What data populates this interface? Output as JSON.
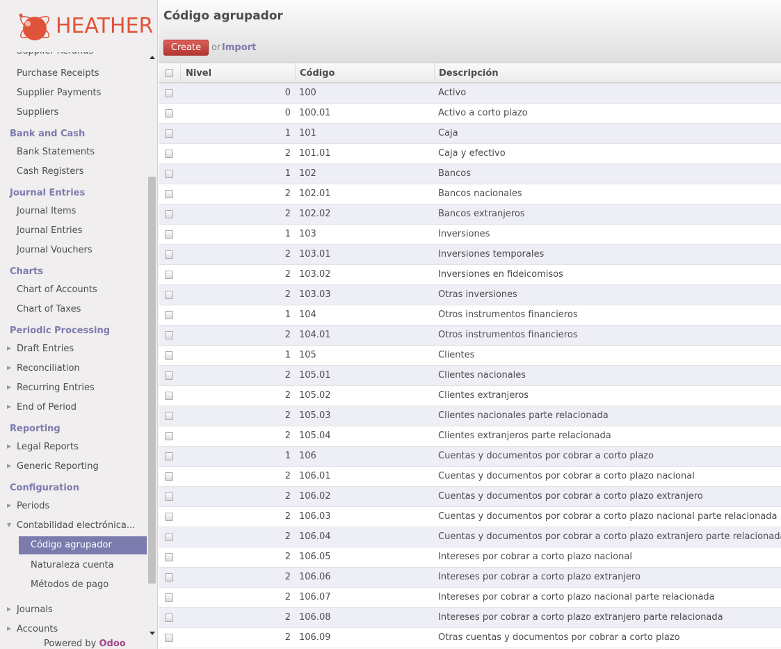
{
  "brand": {
    "name": "HEATHER",
    "powered_prefix": "Powered by ",
    "powered_brand": "Odoo",
    "accent": "#7c7bad",
    "logo_color": "#e0533b"
  },
  "sidebar": {
    "cut_item": "Supplier Refunds",
    "purchase_items": [
      "Purchase Receipts",
      "Supplier Payments",
      "Suppliers"
    ],
    "bank_cash": {
      "title": "Bank and Cash",
      "items": [
        "Bank Statements",
        "Cash Registers"
      ]
    },
    "journal_entries": {
      "title": "Journal Entries",
      "items": [
        "Journal Items",
        "Journal Entries",
        "Journal Vouchers"
      ]
    },
    "charts": {
      "title": "Charts",
      "items": [
        "Chart of Accounts",
        "Chart of Taxes"
      ]
    },
    "periodic": {
      "title": "Periodic Processing",
      "items": [
        "Draft Entries",
        "Reconciliation",
        "Recurring Entries",
        "End of Period"
      ]
    },
    "reporting": {
      "title": "Reporting",
      "items": [
        "Legal Reports",
        "Generic Reporting"
      ]
    },
    "configuration": {
      "title": "Configuration",
      "periods": "Periods",
      "contab": "Contabilidad electrónica...",
      "sub_items": [
        "Código agrupador",
        "Naturaleza cuenta",
        "Métodos de pago"
      ],
      "journals": "Journals",
      "accounts": "Accounts"
    }
  },
  "header": {
    "title": "Código agrupador",
    "create_label": "Create",
    "or_label": "or",
    "import_label": "Import"
  },
  "table": {
    "columns": [
      "Nivel",
      "Código",
      "Descripción"
    ],
    "rows": [
      [
        "0",
        "100",
        "Activo"
      ],
      [
        "0",
        "100.01",
        "Activo a corto plazo"
      ],
      [
        "1",
        "101",
        "Caja"
      ],
      [
        "2",
        "101.01",
        "Caja y efectivo"
      ],
      [
        "1",
        "102",
        "Bancos"
      ],
      [
        "2",
        "102.01",
        "Bancos nacionales"
      ],
      [
        "2",
        "102.02",
        "Bancos extranjeros"
      ],
      [
        "1",
        "103",
        "Inversiones"
      ],
      [
        "2",
        "103.01",
        "Inversiones temporales"
      ],
      [
        "2",
        "103.02",
        "Inversiones en fideicomisos"
      ],
      [
        "2",
        "103.03",
        "Otras inversiones"
      ],
      [
        "1",
        "104",
        "Otros instrumentos financieros"
      ],
      [
        "2",
        "104.01",
        "Otros instrumentos financieros"
      ],
      [
        "1",
        "105",
        "Clientes"
      ],
      [
        "2",
        "105.01",
        "Clientes nacionales"
      ],
      [
        "2",
        "105.02",
        "Clientes extranjeros"
      ],
      [
        "2",
        "105.03",
        "Clientes nacionales parte relacionada"
      ],
      [
        "2",
        "105.04",
        "Clientes extranjeros parte relacionada"
      ],
      [
        "1",
        "106",
        "Cuentas y documentos por cobrar a corto plazo"
      ],
      [
        "2",
        "106.01",
        "Cuentas y documentos por cobrar a corto plazo nacional"
      ],
      [
        "2",
        "106.02",
        "Cuentas y documentos por cobrar a corto plazo extranjero"
      ],
      [
        "2",
        "106.03",
        "Cuentas y documentos por cobrar a corto plazo nacional parte relacionada"
      ],
      [
        "2",
        "106.04",
        "Cuentas y documentos por cobrar a corto plazo extranjero parte relacionada"
      ],
      [
        "2",
        "106.05",
        "Intereses por cobrar a corto plazo nacional"
      ],
      [
        "2",
        "106.06",
        "Intereses por cobrar a corto plazo extranjero"
      ],
      [
        "2",
        "106.07",
        "Intereses por cobrar a corto plazo nacional parte relacionada"
      ],
      [
        "2",
        "106.08",
        "Intereses por cobrar a corto plazo extranjero parte relacionada"
      ],
      [
        "2",
        "106.09",
        "Otras cuentas y documentos por cobrar a corto plazo"
      ]
    ]
  }
}
